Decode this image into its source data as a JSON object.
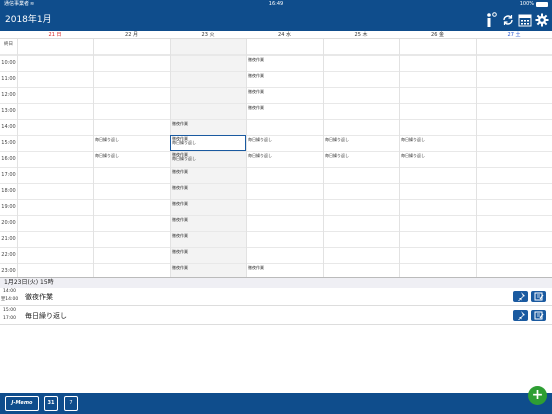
{
  "status_bar": {
    "carrier": "通信事業者",
    "time": "16:49",
    "battery": "100%"
  },
  "nav": {
    "title": "2018年1月"
  },
  "days": [
    {
      "label": "21 日",
      "type": "sun"
    },
    {
      "label": "22 月",
      "type": "week"
    },
    {
      "label": "23 火",
      "type": "week"
    },
    {
      "label": "24 水",
      "type": "week"
    },
    {
      "label": "25 木",
      "type": "week"
    },
    {
      "label": "26 金",
      "type": "week"
    },
    {
      "label": "27 土",
      "type": "sat"
    }
  ],
  "all_day_label": "終日",
  "hours": [
    "10:00",
    "11:00",
    "12:00",
    "13:00",
    "14:00",
    "15:00",
    "16:00",
    "17:00",
    "18:00",
    "19:00",
    "20:00",
    "21:00",
    "22:00",
    "23:00"
  ],
  "grid_events": {
    "e1": "徹夜作業",
    "e2": "徹夜作業",
    "e3": "徹夜作業",
    "e4": "徹夜作業",
    "e5": "徹夜作業",
    "e6": "毎日繰り返し",
    "e7": "徹夜作業",
    "e8": "毎日繰り返し",
    "e9": "毎日繰り返し",
    "e10": "毎日繰り返し",
    "e11": "毎日繰り返し",
    "e12": "毎日繰り返し",
    "e13": "徹夜作業",
    "e14": "毎日繰り返し",
    "e15": "毎日繰り返し",
    "e16": "毎日繰り返し",
    "e17": "毎日繰り返し",
    "e18": "徹夜作業",
    "e19": "徹夜作業",
    "e20": "徹夜作業",
    "e21": "徹夜作業",
    "e22": "徹夜作業",
    "e23": "徹夜作業",
    "e24": "徹夜作業",
    "e25": "徹夜作業"
  },
  "detail": {
    "header": "1月23日(火) 15時",
    "rows": [
      {
        "start": "14:00",
        "end": "翌14:00",
        "title": "徹夜作業"
      },
      {
        "start": "15:00",
        "end": "17:00",
        "title": "毎日繰り返し"
      }
    ]
  },
  "tabbar": {
    "tab1": "J-Memo",
    "tab2": "31",
    "tab3": "7",
    "add": "+"
  }
}
